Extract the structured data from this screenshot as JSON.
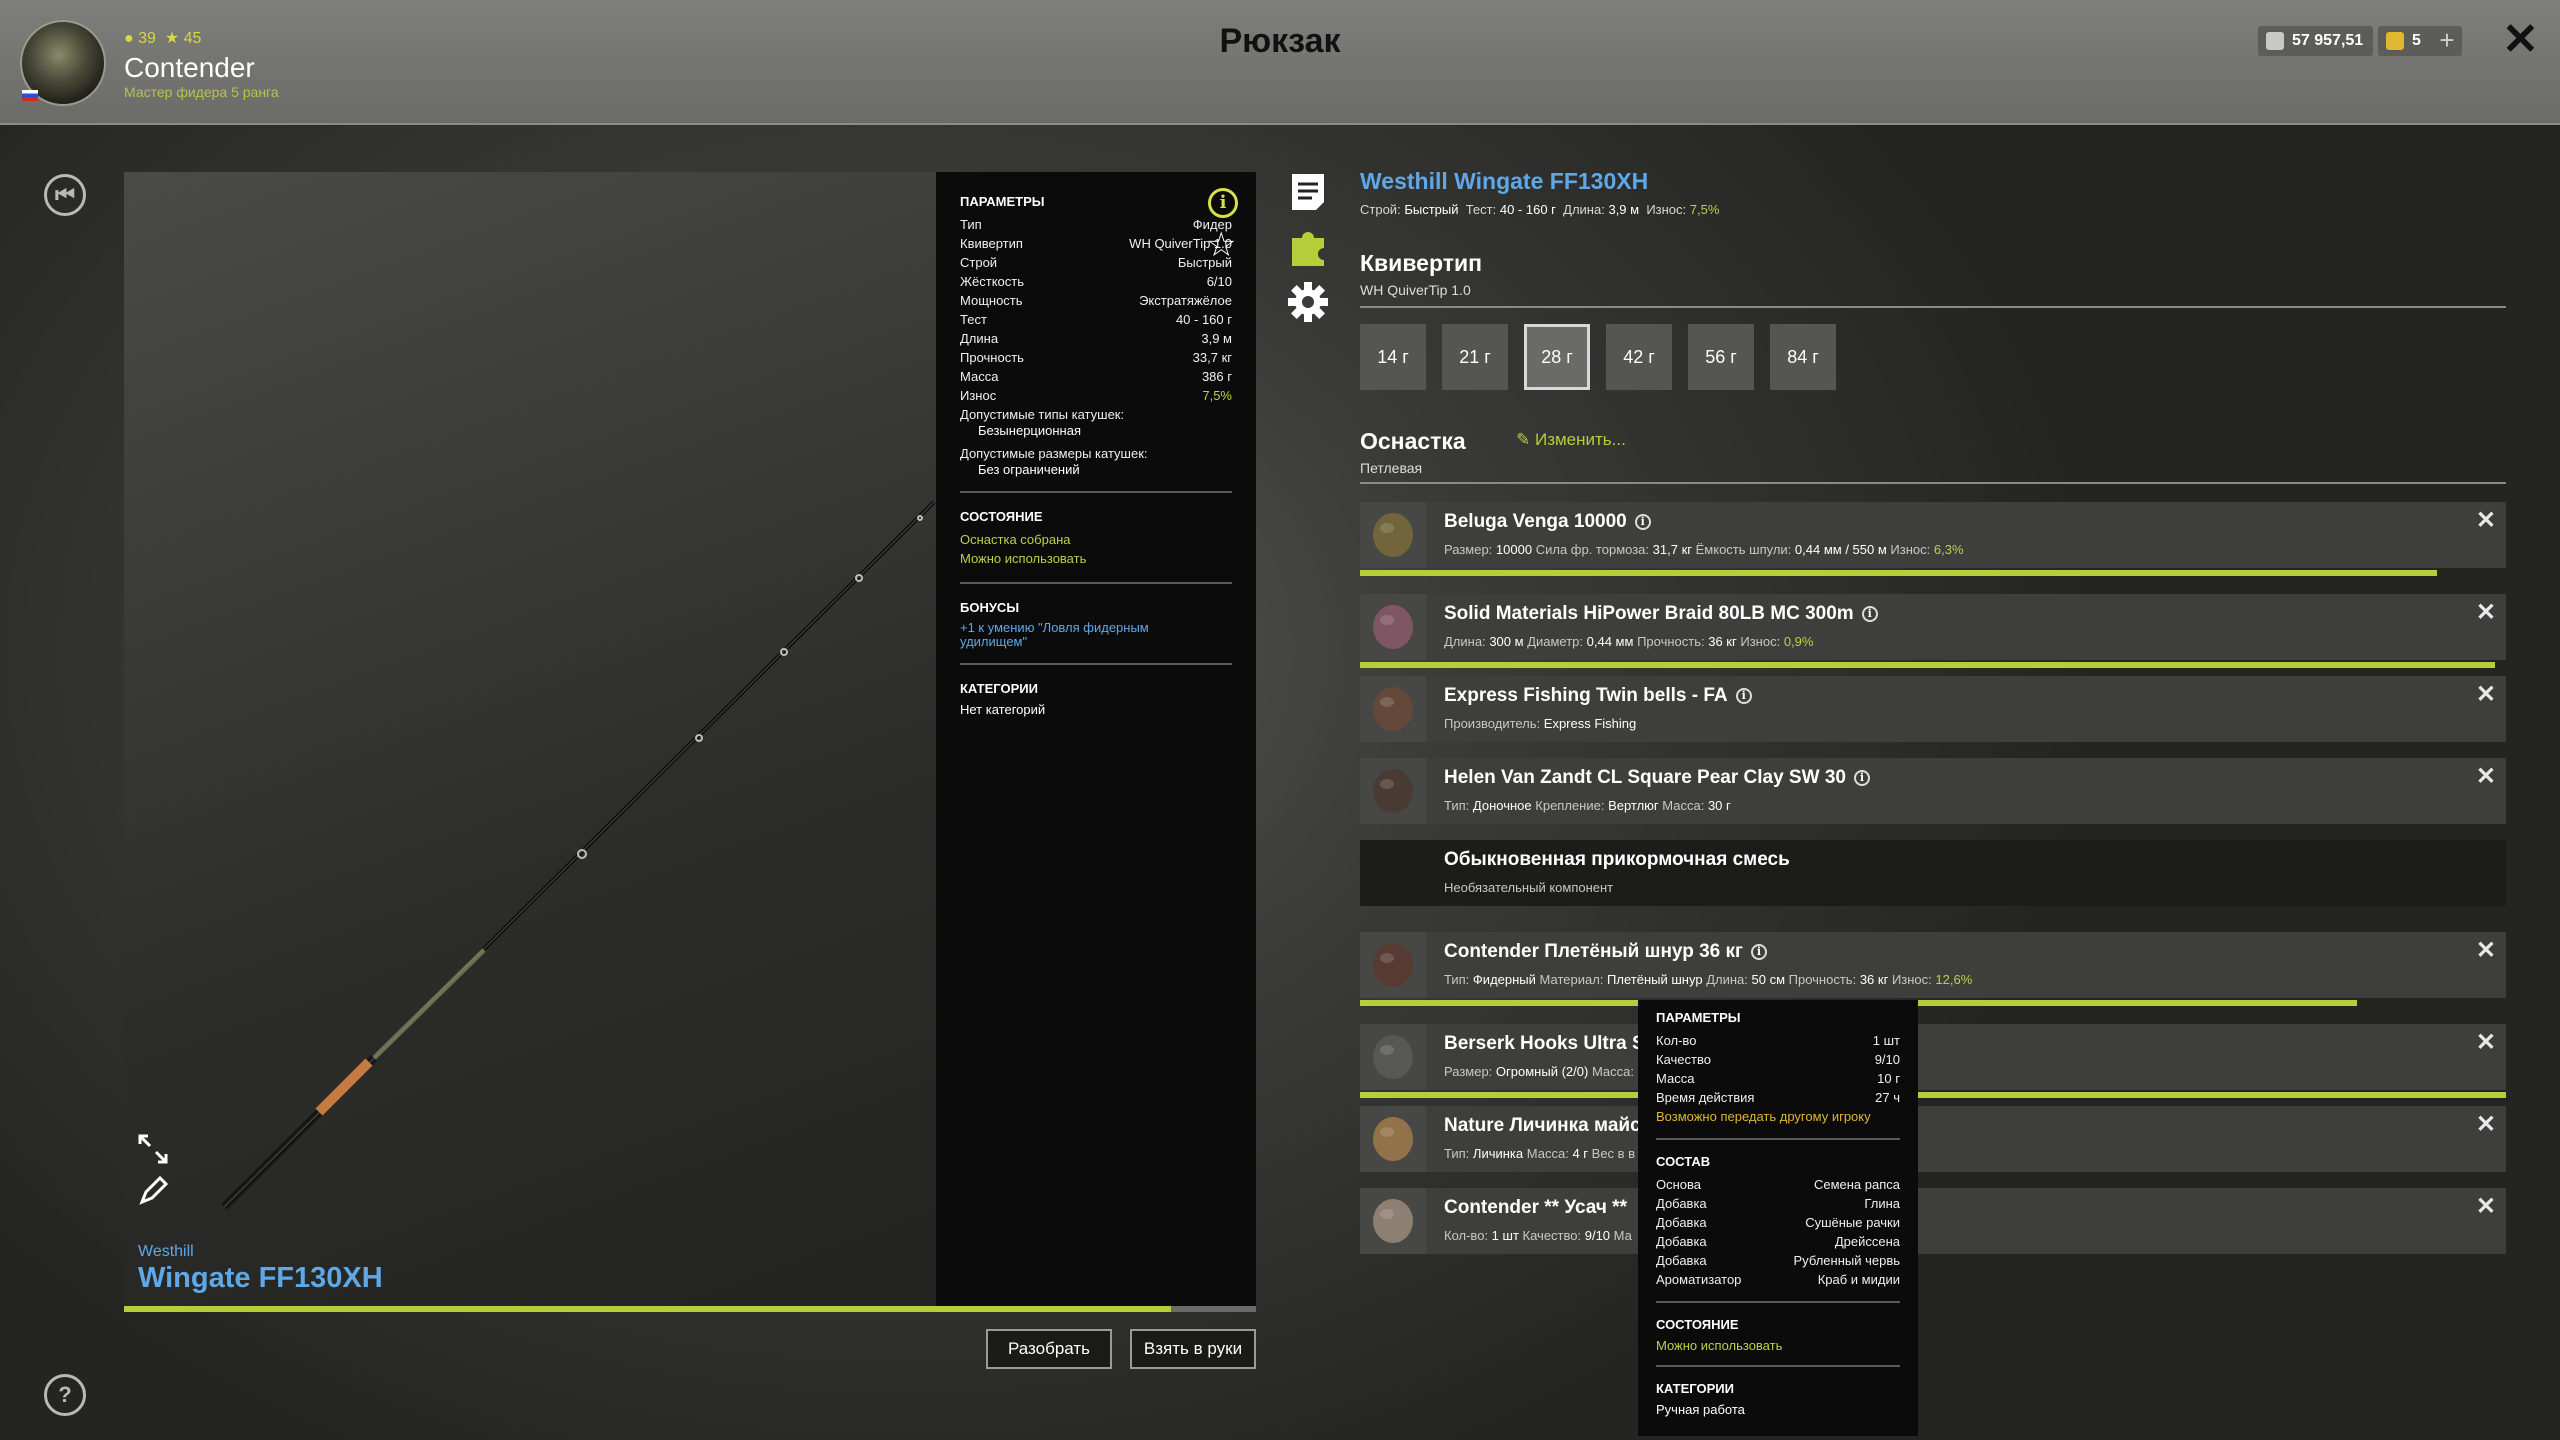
{
  "header": {
    "title": "Рюкзак",
    "player": {
      "name": "Contender",
      "level": "39",
      "rank_points": "45",
      "rank_title": "Мастер фидера 5 ранга"
    },
    "money": "57 957,51",
    "gold": "5",
    "plus": "+",
    "close": "✕"
  },
  "rod": {
    "brand": "Westhill",
    "name": "Wingate FF130XH",
    "wear_fraction": 0.925
  },
  "params": {
    "section_title": "ПАРАМЕТРЫ",
    "rows": [
      {
        "k": "Тип",
        "v": "Фидер"
      },
      {
        "k": "Квивертип",
        "v": "WH QuiverTip 1.0"
      },
      {
        "k": "Строй",
        "v": "Быстрый"
      },
      {
        "k": "Жёсткость",
        "v": "6/10"
      },
      {
        "k": "Мощность",
        "v": "Экстратяжёлое"
      },
      {
        "k": "Тест",
        "v": "40 - 160 г"
      },
      {
        "k": "Длина",
        "v": "3,9 м"
      },
      {
        "k": "Прочность",
        "v": "33,7 кг"
      },
      {
        "k": "Масса",
        "v": "386 г"
      },
      {
        "k": "Износ",
        "v": "7,5%"
      }
    ],
    "reel_types_label": "Допустимые типы катушек:",
    "reel_types_value": "Безынерционная",
    "reel_sizes_label": "Допустимые размеры катушек:",
    "reel_sizes_value": "Без ограничений",
    "state_title": "СОСТОЯНИЕ",
    "state_1": "Оснастка собрана",
    "state_2": "Можно использовать",
    "bonus_title": "БОНУСЫ",
    "bonus_1": "+1 к умению \"Ловля фидерным",
    "bonus_2": "удилищем\"",
    "cat_title": "КАТЕГОРИИ",
    "cat_value": "Нет категорий"
  },
  "buttons": {
    "disassemble": "Разобрать",
    "take": "Взять в руки"
  },
  "right": {
    "title": "Westhill Wingate FF130XH",
    "sub_prefix": "Строй:",
    "sub_action": "Быстрый",
    "sub_test_label": "Тест:",
    "sub_test": "40 - 160 г",
    "sub_len_label": "Длина:",
    "sub_len": "3,9 м",
    "sub_wear_label": "Износ:",
    "sub_wear": "7,5%",
    "quiver_title": "Квивертип",
    "quiver_value": "WH QuiverTip 1.0",
    "tips": [
      "14 г",
      "21 г",
      "28 г",
      "42 г",
      "56 г",
      "84 г"
    ],
    "selected_tip": 2,
    "rig_title": "Оснастка",
    "rig_change": "Изменить...",
    "rig_value": "Петлевая"
  },
  "items": [
    {
      "name": "Beluga Venga 10000",
      "desc_parts": [
        [
          "Размер:",
          "10000"
        ],
        [
          "Сила фр. тормоза:",
          "31,7 кг"
        ],
        [
          "Ёмкость шпули:",
          "0,44 мм / 550 м"
        ]
      ],
      "wear_label": "Износ:",
      "wear": "6,3%",
      "condition": 0.94
    },
    {
      "name": "Solid Materials HiPower Braid 80LB MC 300m",
      "desc_parts": [
        [
          "Длина:",
          "300 м"
        ],
        [
          "Диаметр:",
          "0,44 мм"
        ],
        [
          "Прочность:",
          "36 кг"
        ]
      ],
      "wear_label": "Износ:",
      "wear": "0,9%",
      "condition": 0.99
    },
    {
      "name": "Express Fishing Twin bells - FA",
      "desc_parts": [
        [
          "Производитель:",
          "Express Fishing"
        ]
      ]
    },
    {
      "name": "Helen Van Zandt CL Square Pear Clay SW 30",
      "desc_parts": [
        [
          "Тип:",
          "Доночное"
        ],
        [
          "Крепление:",
          "Вертлюг"
        ],
        [
          "Масса:",
          "30 г"
        ]
      ]
    },
    {
      "name": "Обыкновенная прикормочная смесь",
      "desc_parts": [
        [
          "Необязательный компонент",
          ""
        ]
      ]
    },
    {
      "name": "Contender Плетёный шнур 36 кг",
      "desc_parts": [
        [
          "Тип:",
          "Фидерный"
        ],
        [
          "Материал:",
          "Плетёный шнур"
        ],
        [
          "Длина:",
          "50 см"
        ],
        [
          "Прочность:",
          "36 кг"
        ]
      ],
      "wear_label": "Износ:",
      "wear": "12,6%",
      "condition": 0.87
    },
    {
      "name": "Berserk Hooks Ultra Se",
      "desc_parts": [
        [
          "Размер:",
          "Огромный (2/0)"
        ],
        [
          "Масса:",
          ""
        ]
      ],
      "condition": 1.0
    },
    {
      "name": "Nature Личинка майс",
      "desc_parts": [
        [
          "Тип:",
          "Личинка"
        ],
        [
          "Масса:",
          "4 г"
        ],
        [
          "Вес в в",
          ""
        ]
      ]
    },
    {
      "name": "Contender ** Усач **",
      "desc_parts": [
        [
          "Кол-во:",
          "1 шт"
        ],
        [
          "Качество:",
          "9/10"
        ],
        [
          "Ма",
          ""
        ]
      ]
    }
  ],
  "tooltip": {
    "params_title": "ПАРАМЕТРЫ",
    "params": [
      {
        "k": "Кол-во",
        "v": "1 шт"
      },
      {
        "k": "Качество",
        "v": "9/10"
      },
      {
        "k": "Масса",
        "v": "10 г"
      },
      {
        "k": "Время действия",
        "v": "27 ч"
      }
    ],
    "transfer": "Возможно передать другому игроку",
    "comp_title": "СОСТАВ",
    "comp": [
      {
        "k": "Основа",
        "v": "Семена рапса"
      },
      {
        "k": "Добавка",
        "v": "Глина"
      },
      {
        "k": "Добавка",
        "v": "Сушёные рачки"
      },
      {
        "k": "Добавка",
        "v": "Дрейссена"
      },
      {
        "k": "Добавка",
        "v": "Рубленный червь"
      },
      {
        "k": "Ароматизатор",
        "v": "Краб и мидии"
      }
    ],
    "state_title": "СОСТОЯНИЕ",
    "state": "Можно использовать",
    "cat_title": "КАТЕГОРИИ",
    "cat": "Ручная работа"
  },
  "icons": [
    "back-icon",
    "help-icon",
    "info-icon",
    "star-icon",
    "expand-icon",
    "pencil-icon",
    "document-icon",
    "puzzle-icon",
    "gear-icon",
    "close-icon",
    "edit-icon"
  ],
  "colors": {
    "accent_blue": "#5fa8e8",
    "accent_green": "#b6ce3a"
  }
}
